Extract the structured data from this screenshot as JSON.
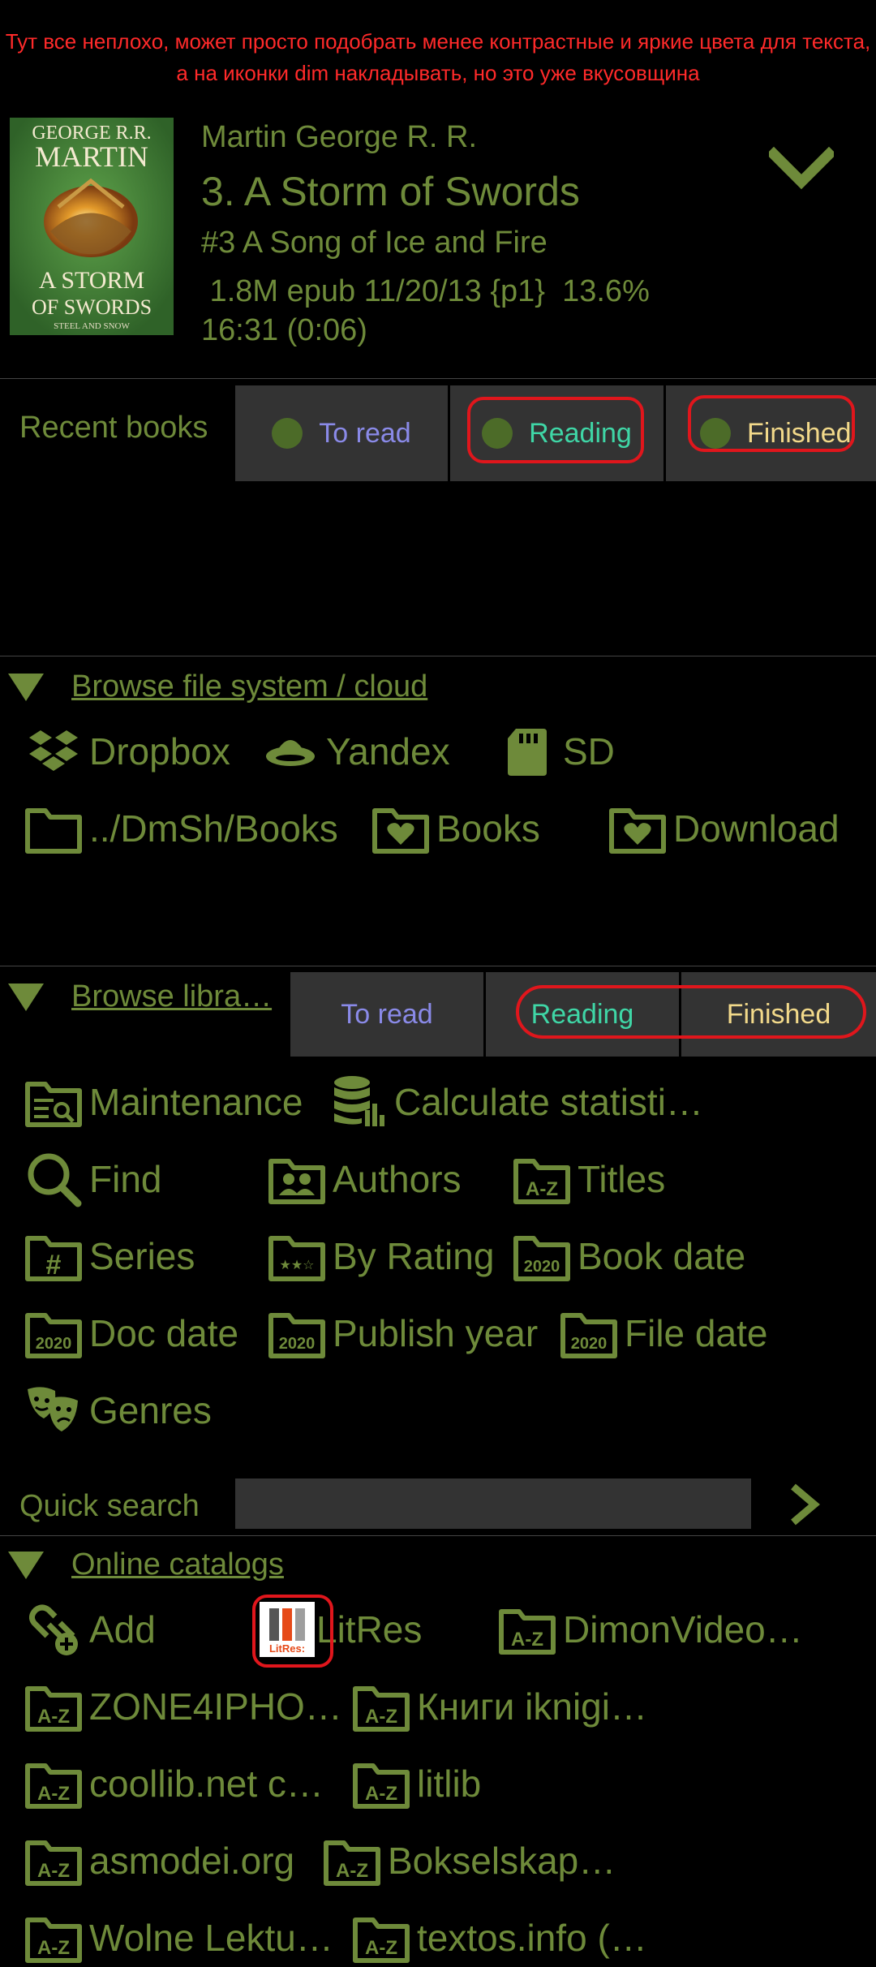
{
  "annotation": "Тут все неплохо, может просто подобрать менее контрастные и яркие цвета для текста, а на иконки dim накладывать, но это уже вкусовщина",
  "book": {
    "author": "Martin George R. R.",
    "title": "3. A Storm of Swords",
    "series": "#3 A Song of Ice and Fire",
    "meta": " 1.8M epub 11/20/13 {p1}  13.6%",
    "time": "16:31 (0:06)",
    "cover_author_line1": "GEORGE R.R.",
    "cover_author_line2": "MARTIN",
    "cover_title_line1": "A STORM",
    "cover_title_line2": "OF SWORDS",
    "cover_subtitle": "STEEL AND SNOW"
  },
  "recent": {
    "label": "Recent books",
    "tabs": [
      "To read",
      "Reading",
      "Finished"
    ]
  },
  "browse_fs": {
    "title": "Browse file system / cloud",
    "items": [
      {
        "label": "Dropbox",
        "icon": "dropbox-icon"
      },
      {
        "label": "Yandex",
        "icon": "yandex-disk-icon"
      },
      {
        "label": "SD",
        "icon": "sd-card-icon"
      },
      {
        "label": "../DmSh/Books",
        "icon": "folder-icon"
      },
      {
        "label": "Books",
        "icon": "favorite-folder-icon"
      },
      {
        "label": "Download",
        "icon": "favorite-folder-icon"
      }
    ]
  },
  "browse_lib": {
    "title": "Browse libra…",
    "tabs": [
      "To read",
      "Reading",
      "Finished"
    ],
    "items": [
      {
        "label": "Maintenance",
        "icon": "maintenance-icon"
      },
      {
        "label": "Calculate statisti…",
        "icon": "database-chart-icon"
      },
      {
        "label": "Find",
        "icon": "search-icon"
      },
      {
        "label": "Authors",
        "icon": "authors-folder-icon"
      },
      {
        "label": "Titles",
        "icon": "az-folder-icon"
      },
      {
        "label": "Series",
        "icon": "hash-folder-icon"
      },
      {
        "label": "By Rating",
        "icon": "stars-folder-icon"
      },
      {
        "label": "Book date",
        "icon": "date-folder-icon"
      },
      {
        "label": "Doc date",
        "icon": "date-folder-icon"
      },
      {
        "label": "Publish year",
        "icon": "date-folder-icon"
      },
      {
        "label": "File date",
        "icon": "date-folder-icon"
      },
      {
        "label": "Genres",
        "icon": "theater-masks-icon"
      }
    ],
    "year_badge": "2020"
  },
  "quick_search": {
    "label": "Quick search",
    "value": ""
  },
  "online": {
    "title": "Online catalogs",
    "items": [
      {
        "label": "Add",
        "icon": "add-link-icon"
      },
      {
        "label": "LitRes",
        "icon": "litres-logo-icon"
      },
      {
        "label": "DimonVideo…",
        "icon": "az-folder-icon"
      },
      {
        "label": "ZONE4IPHO…",
        "icon": "az-folder-icon"
      },
      {
        "label": "Книги iknigi…",
        "icon": "az-folder-icon"
      },
      {
        "label": "coollib.net c…",
        "icon": "az-folder-icon"
      },
      {
        "label": "litlib",
        "icon": "az-folder-icon"
      },
      {
        "label": "asmodei.org",
        "icon": "az-folder-icon"
      },
      {
        "label": "Bokselskap…",
        "icon": "az-folder-icon"
      },
      {
        "label": "Wolne Lektu…",
        "icon": "az-folder-icon"
      },
      {
        "label": "textos.info (…",
        "icon": "az-folder-icon"
      }
    ],
    "litres_badge": "LitRes:"
  },
  "colors": {
    "text": "#6e8a3a",
    "tab_bg": "#333333",
    "to_read": "#8a8ae8",
    "reading": "#3fd6a6",
    "finished": "#f2d98a",
    "annotation": "#ff2a2a",
    "highlight_ring": "#e0161c"
  }
}
